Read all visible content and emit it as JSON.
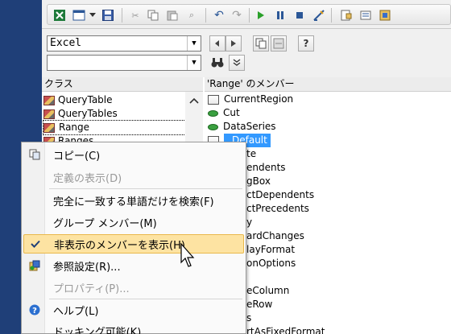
{
  "toolbar": {
    "buttons": [
      "excel-icon",
      "view-icon",
      "dropdown-icon",
      "save-icon",
      "cut-icon",
      "copy-icon",
      "paste-icon",
      "find-icon",
      "undo-icon",
      "redo-icon",
      "run-icon",
      "pause-icon",
      "stop-icon",
      "design-mode-icon",
      "project-explorer-icon",
      "properties-icon",
      "object-browser-icon"
    ]
  },
  "library_select": {
    "value": "Excel"
  },
  "search_select": {
    "value": ""
  },
  "classes_header": "クラス",
  "members_header": "'Range' のメンバー",
  "classes": [
    {
      "label": "QueryTable"
    },
    {
      "label": "QueryTables"
    },
    {
      "label": "Range",
      "selected": true
    },
    {
      "label": "Ranges"
    }
  ],
  "members": [
    {
      "label": "CurrentRegion",
      "kind": "property"
    },
    {
      "label": "Cut",
      "kind": "method"
    },
    {
      "label": "DataSeries",
      "kind": "method"
    },
    {
      "label": "_Default",
      "kind": "property",
      "selected": true
    },
    {
      "label": "te"
    },
    {
      "label": "endents"
    },
    {
      "label": "gBox"
    },
    {
      "label": "ctDependents"
    },
    {
      "label": "ctPrecedents"
    },
    {
      "label": "y"
    },
    {
      "label": "ardChanges"
    },
    {
      "label": "layFormat"
    },
    {
      "label": "onOptions"
    },
    {
      "label": ""
    },
    {
      "label": "eColumn"
    },
    {
      "label": "eRow"
    },
    {
      "label": "s"
    },
    {
      "label": "rtAsFixedFormat"
    }
  ],
  "context_menu": {
    "items": [
      {
        "label": "コピー(C)",
        "icon": "copy-icon",
        "disabled": false
      },
      {
        "label": "定義の表示(D)",
        "icon": "",
        "disabled": true
      },
      {
        "label": "完全に一致する単語だけを検索(F)",
        "icon": "",
        "disabled": false
      },
      {
        "label": "グループ メンバー(M)",
        "icon": "",
        "disabled": false
      },
      {
        "label": "非表示のメンバーを表示(H)",
        "icon": "check-icon",
        "disabled": false,
        "highlight": true
      },
      {
        "label": "参照設定(R)...",
        "icon": "references-icon",
        "disabled": false
      },
      {
        "label": "プロパティ(P)...",
        "icon": "",
        "disabled": true
      },
      {
        "label": "ヘルプ(L)",
        "icon": "help-icon",
        "disabled": false
      },
      {
        "label": "ドッキング可能(K)",
        "icon": "",
        "disabled": false
      }
    ]
  },
  "colors": {
    "selection": "#3399ff",
    "menu_highlight": "#fde3a2",
    "window_strip": "#1f3f78"
  }
}
